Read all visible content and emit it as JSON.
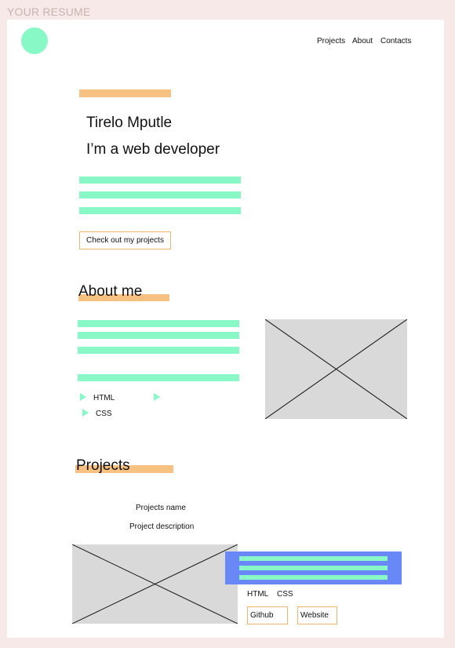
{
  "frame": {
    "title": "YOUR RESUME"
  },
  "nav": {
    "items": [
      "Projects",
      "About",
      "Contacts"
    ]
  },
  "hero": {
    "name": "Tirelo Mputle",
    "tagline": "I’m a web developer",
    "cta_label": "Check out my projects"
  },
  "about": {
    "title": "About me",
    "skills": [
      "HTML",
      "",
      "CSS"
    ]
  },
  "projects": {
    "title": "Projects",
    "project_name": "Projects name",
    "project_description": "Project description",
    "tags": [
      "HTML",
      "CSS"
    ],
    "github_label": "Github",
    "website_label": "Website"
  },
  "colors": {
    "background": "#f6e9e8",
    "accent_orange": "#f7c182",
    "accent_green": "#88f9c6",
    "accent_blue": "#6a87f7",
    "placeholder_gray": "#d9d9d9"
  }
}
